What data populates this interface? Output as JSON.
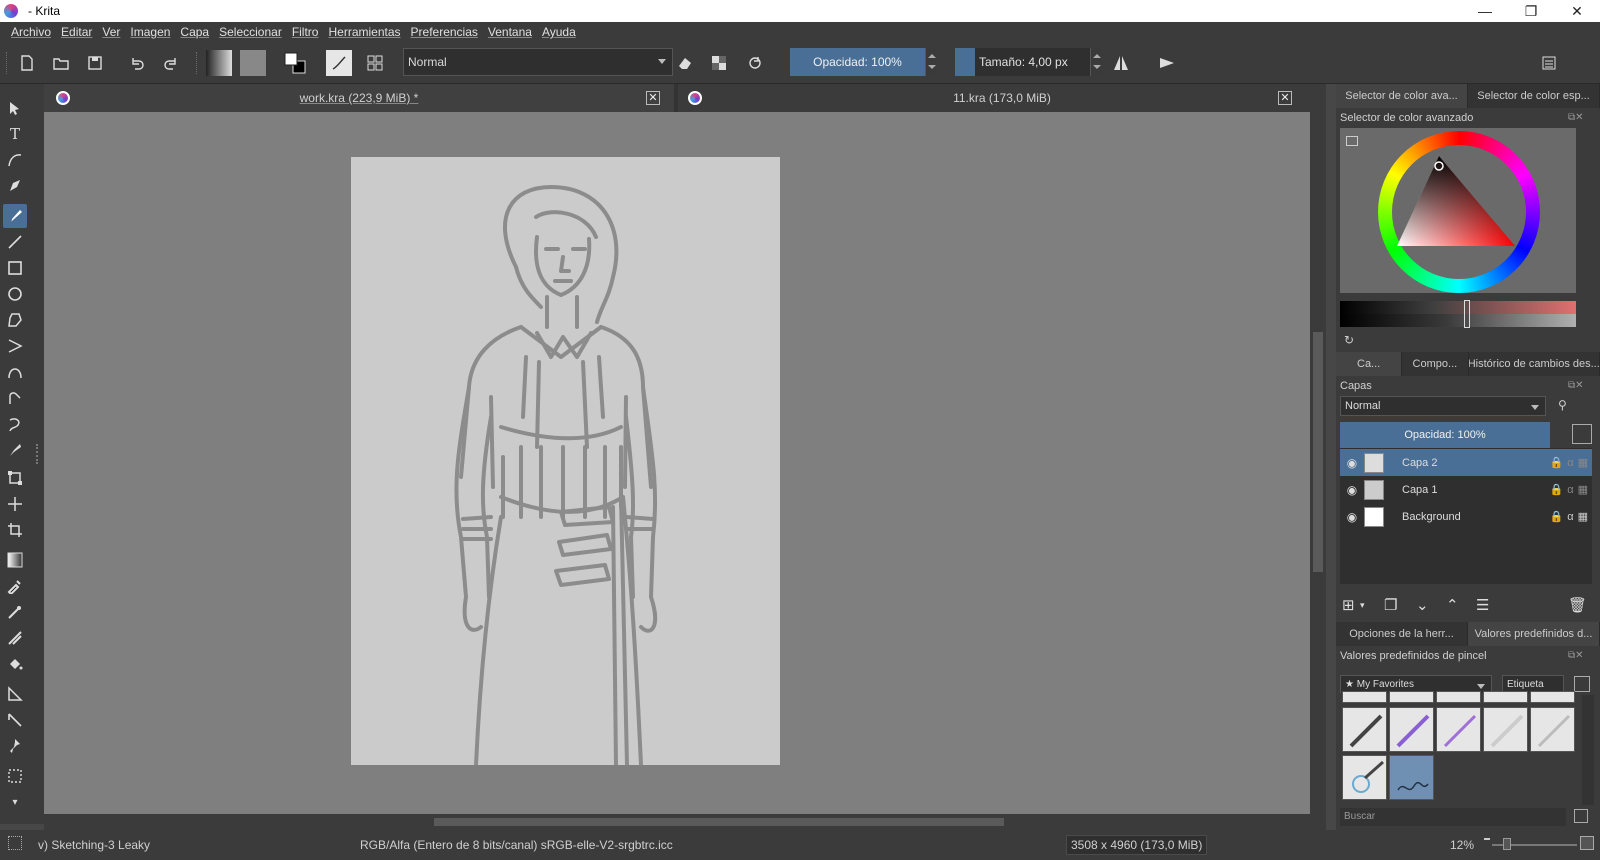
{
  "window": {
    "title": "- Krita",
    "controls": [
      "—",
      "❐",
      "✕"
    ]
  },
  "menu": [
    "Archivo",
    "Editar",
    "Ver",
    "Imagen",
    "Capa",
    "Seleccionar",
    "Filtro",
    "Herramientas",
    "Preferencias",
    "Ventana",
    "Ayuda"
  ],
  "toolbar": {
    "blend_mode": "Normal",
    "opacity_label": "Opacidad:  100%",
    "size_label": "Tamaño:  4,00 px"
  },
  "documents": [
    {
      "label": "work.kra (223,9 MiB) *",
      "active": true
    },
    {
      "label": "11.kra (173,0 MiB)",
      "active": false
    }
  ],
  "right_dock": {
    "top_tabs": [
      "Selector de color ava...",
      "Selector de color esp..."
    ],
    "color_selector_title": "Selector de color avanzado",
    "mid_tabs": [
      "Ca...",
      "Compo...",
      "Histórico de cambios des..."
    ],
    "layers_title": "Capas",
    "layer_blend": "Normal",
    "layer_opacity": "Opacidad:  100%",
    "layers": [
      {
        "name": "Capa 2",
        "active": true
      },
      {
        "name": "Capa 1",
        "active": false
      },
      {
        "name": "Background",
        "active": false
      }
    ],
    "bottom_tabs": [
      "Opciones de la herr...",
      "Valores predefinidos d..."
    ],
    "brush_title": "Valores predefinidos de pincel",
    "brush_tag": "★ My Favorites",
    "tag_button": "Etiqueta",
    "search_placeholder": "Buscar"
  },
  "status": {
    "brush": "v) Sketching-3 Leaky",
    "color_space": "RGB/Alfa (Entero de 8 bits/canal)  sRGB-elle-V2-srgbtrc.icc",
    "image_size": "3508 x 4960 (173,0 MiB)",
    "zoom": "12%"
  },
  "colors": {
    "accent": "#4a6f96",
    "panel": "#3b3b3b",
    "canvas_bg": "#7f7f7f",
    "page": "#cbcbcb",
    "sketch": "#8c8c8c"
  }
}
